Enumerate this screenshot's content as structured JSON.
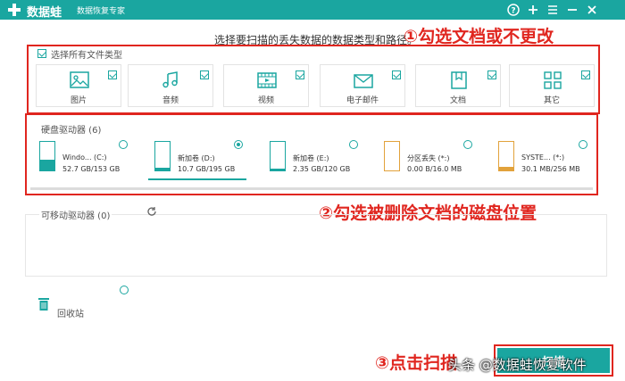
{
  "app": {
    "name": "数据蛙",
    "subtitle": "数据恢复专家"
  },
  "instruction": "选择要扫描的丢失数据的数据类型和路径。",
  "annotations": {
    "step1": "①勾选文档或不更改",
    "step2": "②勾选被删除文档的磁盘位置",
    "step3": "③点击扫描"
  },
  "file_types": {
    "select_all_label": "选择所有文件类型",
    "items": [
      {
        "label": "图片",
        "icon": "image-icon",
        "checked": true
      },
      {
        "label": "音频",
        "icon": "music-icon",
        "checked": true
      },
      {
        "label": "视频",
        "icon": "video-icon",
        "checked": true
      },
      {
        "label": "电子邮件",
        "icon": "email-icon",
        "checked": true
      },
      {
        "label": "文档",
        "icon": "document-icon",
        "checked": true
      },
      {
        "label": "其它",
        "icon": "other-icon",
        "checked": true
      }
    ]
  },
  "hard_drives": {
    "label": "硬盘驱动器 (6)",
    "items": [
      {
        "name": "Windo... (C:)",
        "size": "52.7 GB/153 GB",
        "selected": false
      },
      {
        "name": "新加卷 (D:)",
        "size": "10.7 GB/195 GB",
        "selected": true
      },
      {
        "name": "新加卷 (E:)",
        "size": "2.35 GB/120 GB",
        "selected": false
      },
      {
        "name": "分区丢失 (*:)",
        "size": "0.00 B/16.0 MB",
        "selected": false
      },
      {
        "name": "SYSTE... (*:)",
        "size": "30.1 MB/256 MB",
        "selected": false
      }
    ]
  },
  "removable": {
    "label": "可移动驱动器 (0)"
  },
  "recycle_bin": {
    "label": "回收站"
  },
  "scan_button": {
    "label": "扫描"
  },
  "watermark": "头条 @数据蛙恢复软件",
  "colors": {
    "accent": "#1aa6a0",
    "annotation": "#e0261f"
  }
}
